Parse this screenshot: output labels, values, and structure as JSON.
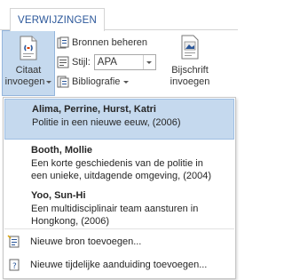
{
  "ribbon": {
    "active_tab": "VERWIJZINGEN",
    "cite_button": {
      "line1": "Citaat",
      "line2": "invoegen",
      "icon": "insert-citation-icon"
    },
    "manage_sources": {
      "label": "Bronnen beheren",
      "icon": "manage-sources-icon"
    },
    "style": {
      "label": "Stijl:",
      "value": "APA",
      "icon": "style-icon"
    },
    "bibliography": {
      "label": "Bibliografie",
      "icon": "bibliography-icon"
    },
    "caption_button": {
      "line1": "Bijschrift",
      "line2": "invoegen",
      "icon": "insert-caption-icon"
    }
  },
  "dropdown": {
    "sources": [
      {
        "author": "Alima, Perrine, Hurst, Katri",
        "title_lines": [
          "Politie in een nieuwe eeuw, (2006)"
        ],
        "highlighted": true
      },
      {
        "author": "Booth, Mollie",
        "title_lines": [
          "Een korte geschiedenis van de politie in",
          "een unieke, uitdagende omgeving, (2004)"
        ],
        "highlighted": false
      },
      {
        "author": "Yoo, Sun-Hi",
        "title_lines": [
          "Een multidisciplinair team aansturen in",
          "Hongkong, (2006)"
        ],
        "highlighted": false
      }
    ],
    "menu": [
      {
        "label": "Nieuwe bron toevoegen...",
        "icon": "add-source-icon"
      },
      {
        "label": "Nieuwe tijdelijke aanduiding toevoegen...",
        "icon": "add-placeholder-icon"
      }
    ]
  },
  "colors": {
    "accent": "#2b579a",
    "highlight": "#c5d9ee",
    "highlight_border": "#9fbfe3"
  }
}
